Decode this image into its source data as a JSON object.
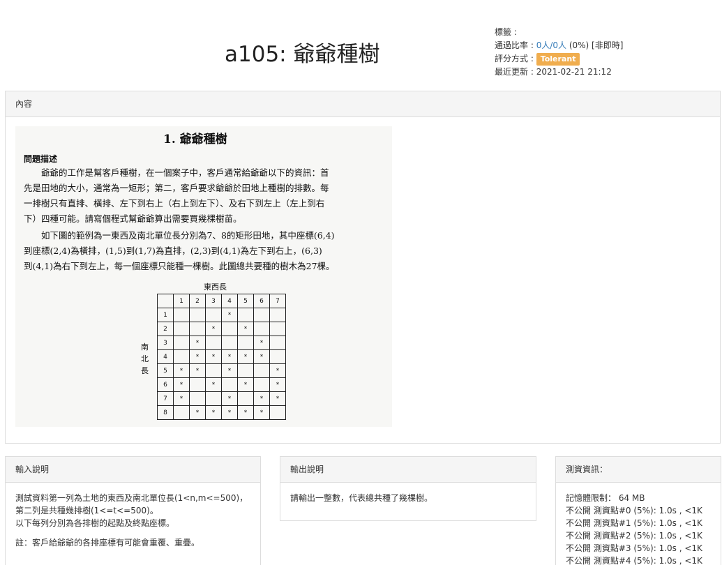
{
  "header": {
    "title": "a105: 爺爺種樹"
  },
  "meta": {
    "tags_label": "標籤 :",
    "pass_rate_label": "通過比率 : ",
    "pass_rate_link": "0人/0人",
    "pass_rate_tail": " (0%) [非即時]",
    "scoring_label": "評分方式 : ",
    "scoring_badge": "Tolerant",
    "updated_label": "最近更新 : ",
    "updated_value": "2021-02-21 21:12"
  },
  "content": {
    "heading": "內容",
    "image": {
      "title": "1.  爺爺種樹",
      "sub": "問題描述",
      "para1": [
        "　　爺爺的工作是幫客戶種樹，在一個案子中，客戶通常給爺爺以下的資訊：首",
        "先是田地的大小，通常為一矩形；第二，客戶要求爺爺於田地上種樹的排數。每",
        "一排樹只有直排、橫排、左下到右上（右上到左下）、及右下到左上（左上到右",
        "下）四種可能。請寫個程式幫爺爺算出需要買幾棵樹苗。"
      ],
      "para2": [
        "　　如下圖的範例為一東西及南北單位長分別為7、8的矩形田地，其中座標(6,4)",
        "到座標(2,4)為橫排，(1,5)到(1,7)為直排，(2,3)到(4,1)為左下到右上，(6,3)",
        "到(4,1)為右下到左上，每一個座標只能種一棵樹。此圖總共要種的樹木為27棵。"
      ],
      "grid_top_label": "東西長",
      "grid_side_label": "南北長",
      "grid_rows": [
        [
          "",
          "1",
          "2",
          "3",
          "4",
          "5",
          "6",
          "7"
        ],
        [
          "1",
          "",
          "",
          "",
          "*",
          "",
          "",
          ""
        ],
        [
          "2",
          "",
          "",
          "*",
          "",
          "*",
          "",
          ""
        ],
        [
          "3",
          "",
          "*",
          "",
          "",
          "",
          "*",
          ""
        ],
        [
          "4",
          "",
          "*",
          "*",
          "*",
          "*",
          "*",
          ""
        ],
        [
          "5",
          "*",
          "*",
          "",
          "*",
          "",
          "",
          "*"
        ],
        [
          "6",
          "*",
          "",
          "*",
          "",
          "*",
          "",
          "*"
        ],
        [
          "7",
          "*",
          "",
          "",
          "*",
          "",
          "*",
          "*"
        ],
        [
          "8",
          "",
          "*",
          "*",
          "*",
          "*",
          "*",
          ""
        ]
      ]
    }
  },
  "input": {
    "heading": "輸入說明",
    "lines": [
      "測試資料第一列為土地的東西及南北單位長(1<n,m<=500)，",
      "第二列是共種幾排樹(1<=t<=500)。",
      "以下每列分別為各排樹的起點及終點座標。"
    ],
    "note": "註：客戶給爺爺的各排座標有可能會重覆、重疊。"
  },
  "output": {
    "heading": "輸出說明",
    "text": "請輸出一整數，代表總共種了幾棵樹。"
  },
  "info": {
    "heading": "測資資訊：",
    "memory": "記憶體限制： 64 MB",
    "tests": [
      "不公開 測資點#0 (5%): 1.0s , <1K",
      "不公開 測資點#1 (5%): 1.0s , <1K",
      "不公開 測資點#2 (5%): 1.0s , <1K",
      "不公開 測資點#3 (5%): 1.0s , <1K",
      "不公開 測資點#4 (5%): 1.0s , <1K"
    ]
  }
}
